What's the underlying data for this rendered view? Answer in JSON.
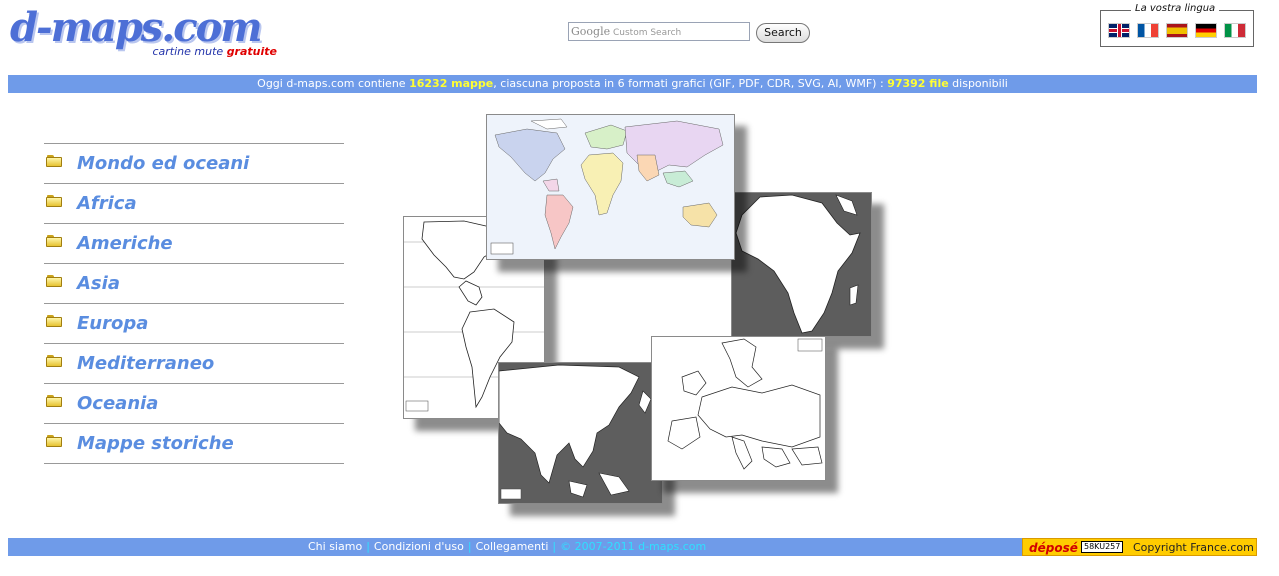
{
  "logo": {
    "text": "d-maps.com",
    "tagline": "cartine mute",
    "tagline_free": "gratuite"
  },
  "search": {
    "google": "Google",
    "placeholder": "Custom Search",
    "button": "Search"
  },
  "language": {
    "title": "La vostra lingua",
    "flags": [
      "english-flag",
      "french-flag",
      "spanish-flag",
      "german-flag",
      "italian-flag"
    ]
  },
  "info": {
    "prefix": "Oggi d-maps.com contiene",
    "maps_count": "16232 mappe",
    "middle": ", ciascuna proposta in 6 formati grafici (GIF, PDF, CDR, SVG, AI, WMF) :",
    "files_count": "97392 file",
    "suffix": "disponibili"
  },
  "menu": {
    "items": [
      {
        "label": "Mondo ed oceani"
      },
      {
        "label": "Africa"
      },
      {
        "label": "Americhe"
      },
      {
        "label": "Asia"
      },
      {
        "label": "Europa"
      },
      {
        "label": "Mediterraneo"
      },
      {
        "label": "Oceania"
      },
      {
        "label": "Mappe storiche"
      }
    ]
  },
  "footer": {
    "links": [
      "Chi siamo",
      "Condizioni d'uso",
      "Collegamenti"
    ],
    "copyright": "© 2007-2011 d-maps.com",
    "badge_depose": "déposé",
    "badge_code": "58KU257",
    "badge_site": "Copyright France.com"
  },
  "colors": {
    "bar": "#6f9be9",
    "menu_text": "#5a8de0",
    "highlight": "#ffff33"
  }
}
